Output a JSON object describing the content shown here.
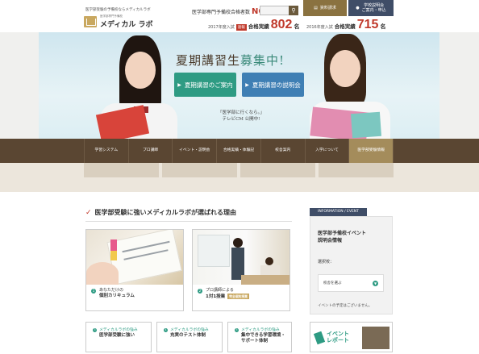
{
  "header": {
    "tagline": "医学部受験の予備校ならメディカルラボ",
    "logo_sub": "医学部専門予備校",
    "logo_text": "メディカル ラボ",
    "rank_label": "医学部専門予備校合格者数",
    "rank_value": "NO.1",
    "search_icon": "search-icon",
    "request_button": "資料請求",
    "explain_button_line1": "学校説明会",
    "explain_button_line2": "ご案内・申込",
    "stat1": {
      "year": "2017年度入試",
      "badge": "速報",
      "label": "合格実績",
      "value": "802",
      "unit": "名"
    },
    "stat2": {
      "year": "2016年度入試",
      "label": "合格実績",
      "value": "715",
      "unit": "名"
    }
  },
  "hero": {
    "title_a": "夏期講習生",
    "title_b": "募集中!",
    "button_a": "夏期講習のご案内",
    "button_b": "夏期講習の説明会",
    "cm_line1": "「医学部に行くなら。」",
    "cm_line2": "テレビCM 公開中!"
  },
  "nav": {
    "items": [
      {
        "label": "学習システム"
      },
      {
        "label": "プロ講師"
      },
      {
        "label": "イベント・説明会"
      },
      {
        "label": "合格実績・体験記"
      },
      {
        "label": "校舎案内"
      },
      {
        "label": "入学について"
      },
      {
        "label": "医学部受験情報"
      }
    ]
  },
  "main": {
    "section_title": "医学部受験に強いメディカルラボが選ばれる理由",
    "cards": [
      {
        "num": "1",
        "line1": "あなただけの",
        "line2": "個別カリキュラム"
      },
      {
        "num": "2",
        "line1": "プロ講師による",
        "line2": "1対1授業",
        "tag": "完全個別授業"
      }
    ],
    "small_cards": [
      {
        "num": "3",
        "line1": "メディカルラボの強み",
        "line2": "医学部受験に強い"
      },
      {
        "num": "4",
        "line1": "メディカルラボの強み",
        "line2": "充実のテスト体制"
      },
      {
        "num": "5",
        "line1": "メディカルラボの強み",
        "line2": "集中できる学習環境・サポート体制"
      }
    ]
  },
  "sidebar": {
    "tag": "INFORMATION / EVENT",
    "title_line1": "医学部予備校イベント",
    "title_line2": "説明会情報",
    "select_label": "選択校：",
    "select_value": "校舎を選ぶ",
    "note": "イベントの予定はございません。",
    "report_line1": "イベント",
    "report_line2": "レポート"
  }
}
